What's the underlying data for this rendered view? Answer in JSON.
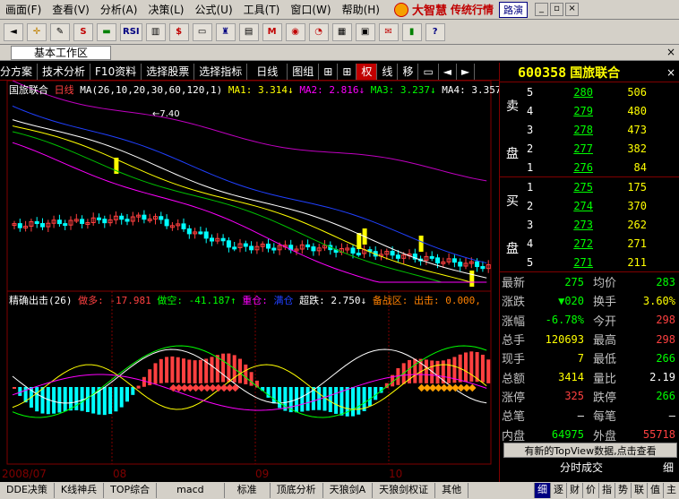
{
  "menu": {
    "items": [
      "画面(F)",
      "查看(V)",
      "分析(A)",
      "决策(L)",
      "公式(U)",
      "工具(T)",
      "窗口(W)",
      "帮助(H)"
    ],
    "brand": "大智慧",
    "brand_sub": "传统行情",
    "road_button": "路演"
  },
  "toolbar": {
    "items": [
      "◄",
      "✛",
      "✎",
      "S",
      "▬",
      "RSI",
      "▥",
      "$",
      "▭",
      "♜",
      "▤",
      "M",
      "◉",
      "◔",
      "▦",
      "▣",
      "✉",
      "▮",
      "?"
    ]
  },
  "worktab": {
    "label": "基本工作区"
  },
  "charttoolbar": {
    "items": [
      "分方案",
      "技术分析",
      "F10资料",
      "选择股票",
      "选择指标",
      "日线",
      "图组",
      "⊞",
      "⊞",
      "权",
      "线",
      "移",
      "▭",
      "◄",
      "►"
    ],
    "active_index": 9
  },
  "stock": {
    "code": "600358",
    "name": "国旅联合"
  },
  "main_legend": {
    "name": "国旅联合",
    "period": "日线",
    "ma": "MA(26,10,20,30,60,120,1)",
    "ma1": "MA1: 3.314↓",
    "ma2": "MA2: 2.816↓",
    "ma3": "MA3: 3.237↓",
    "ma4": "MA4: 3.357↓",
    "high_label": "7.40"
  },
  "sub_legend": {
    "title": "精确出击(26)",
    "item1": "做多: -17.981",
    "item2": "做空: -41.187↑",
    "item3": "重仓:",
    "item4": "满仓",
    "item5": "超跌: 2.750↓",
    "item6": "备战区: 出击: 0.000,"
  },
  "axis": {
    "dates": [
      "2008/07",
      "08",
      "09",
      "10"
    ]
  },
  "orderbook": {
    "sell_label": [
      "卖",
      "盘"
    ],
    "buy_label": [
      "买",
      "盘"
    ],
    "sell": [
      {
        "level": "5",
        "price": "280",
        "volume": "506"
      },
      {
        "level": "4",
        "price": "279",
        "volume": "480"
      },
      {
        "level": "3",
        "price": "278",
        "volume": "473"
      },
      {
        "level": "2",
        "price": "277",
        "volume": "382"
      },
      {
        "level": "1",
        "price": "276",
        "volume": "84"
      }
    ],
    "buy": [
      {
        "level": "1",
        "price": "275",
        "volume": "175"
      },
      {
        "level": "2",
        "price": "274",
        "volume": "370"
      },
      {
        "level": "3",
        "price": "273",
        "volume": "262"
      },
      {
        "level": "4",
        "price": "272",
        "volume": "271"
      },
      {
        "level": "5",
        "price": "271",
        "volume": "211"
      }
    ]
  },
  "quotes": [
    {
      "k1": "最新",
      "v1": "275",
      "c1": "#00ff00",
      "k2": "均价",
      "v2": "283",
      "c2": "#00ff00"
    },
    {
      "k1": "涨跌",
      "v1": "▼020",
      "c1": "#00ff00",
      "k2": "换手",
      "v2": "3.60%",
      "c2": "#ffff00"
    },
    {
      "k1": "涨幅",
      "v1": "-6.78%",
      "c1": "#00ff00",
      "k2": "今开",
      "v2": "298",
      "c2": "#ff4040"
    },
    {
      "k1": "总手",
      "v1": "120693",
      "c1": "#ffff00",
      "k2": "最高",
      "v2": "298",
      "c2": "#ff4040"
    },
    {
      "k1": "现手",
      "v1": "7",
      "c1": "#ffff00",
      "k2": "最低",
      "v2": "266",
      "c2": "#00ff00"
    },
    {
      "k1": "总额",
      "v1": "3414",
      "c1": "#ffff00",
      "k2": "量比",
      "v2": "2.19",
      "c2": "#ffffff"
    },
    {
      "k1": "涨停",
      "v1": "325",
      "c1": "#ff4040",
      "k2": "跌停",
      "v2": "266",
      "c2": "#00ff00"
    },
    {
      "k1": "总笔",
      "v1": "—",
      "c1": "#ffffff",
      "k2": "每笔",
      "v2": "—",
      "c2": "#ffffff"
    },
    {
      "k1": "内盘",
      "v1": "64975",
      "c1": "#00ff00",
      "k2": "外盘",
      "v2": "55718",
      "c2": "#ff4040"
    }
  ],
  "topview": "有新的TopView数据,点击查看",
  "timedeal": "分时成交",
  "detail": "细",
  "bottomtabs": [
    "DDE决策",
    "K线神兵",
    "TOP综合",
    "macd",
    "标准",
    "顶底分析",
    "天狼剑A",
    "天狼剑权证",
    "其他"
  ],
  "bottomright": [
    "细",
    "逐",
    "财",
    "价",
    "指",
    "势",
    "联",
    "值",
    "主"
  ],
  "colors": {
    "up": "#ff4040",
    "down": "#00ffff",
    "yellow": "#ffff00",
    "ma_white": "#ffffff",
    "ma_yellow": "#ffff00",
    "ma_magenta": "#ff00ff",
    "ma_green": "#00c000",
    "ma_blue": "#2040ff",
    "ma_purple": "#c000c0"
  }
}
